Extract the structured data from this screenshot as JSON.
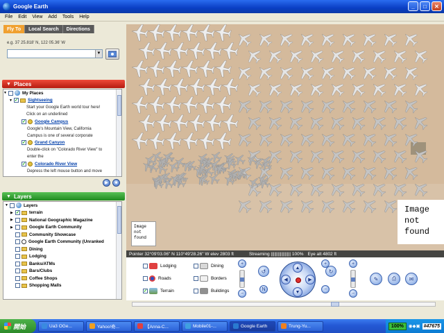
{
  "window": {
    "title": "Google Earth"
  },
  "menu": [
    "File",
    "Edit",
    "View",
    "Add",
    "Tools",
    "Help"
  ],
  "tabs": [
    {
      "label": "Fly To",
      "active": true
    },
    {
      "label": "Local Search",
      "active": false
    },
    {
      "label": "Directions",
      "active": false
    }
  ],
  "flyto": {
    "example": "e.g. 37 25.818' N, 122 05.36' W",
    "value": ""
  },
  "places": {
    "header": "Places",
    "root": "My Places",
    "sightseeing": "Sightseeing",
    "intro1": "Start your Google Earth world tour here!",
    "intro2": "Click on an underlined",
    "items": [
      {
        "label": "Google Campus",
        "desc1": "Google's Mountain View, California",
        "desc2": "Campus is one of several corporate"
      },
      {
        "label": "Grand Canyon",
        "desc1": "Double-click on \"Colorado River View\" to",
        "desc2": "enter the"
      },
      {
        "label": "Colorado River View",
        "desc1": "Depress the left mouse button and move"
      }
    ]
  },
  "layers": {
    "header": "Layers",
    "items": [
      {
        "label": "Layers",
        "checked": false,
        "bold": true,
        "kind": "globe"
      },
      {
        "label": "terrain",
        "checked": true,
        "bold": true,
        "kind": "folder"
      },
      {
        "label": "National Geographic Magazine",
        "checked": false,
        "bold": true,
        "kind": "folder"
      },
      {
        "label": "Google Earth Community",
        "checked": false,
        "bold": true,
        "kind": "folder"
      },
      {
        "label": "Community Showcase",
        "checked": false,
        "bold": true,
        "kind": "folder"
      },
      {
        "label": "Google Earth Community (Unranked",
        "checked": false,
        "bold": true,
        "kind": "info"
      },
      {
        "label": "Dining",
        "checked": false,
        "bold": true,
        "kind": "folder"
      },
      {
        "label": "Lodging",
        "checked": false,
        "bold": true,
        "kind": "folder"
      },
      {
        "label": "Banks/ATMs",
        "checked": false,
        "bold": true,
        "kind": "folder"
      },
      {
        "label": "Bars/Clubs",
        "checked": false,
        "bold": true,
        "kind": "folder"
      },
      {
        "label": "Coffee Shops",
        "checked": false,
        "bold": true,
        "kind": "folder"
      },
      {
        "label": "Shopping Malls",
        "checked": false,
        "bold": true,
        "kind": "folder"
      }
    ]
  },
  "map": {
    "image_not_found_small": "Image\nnot\nfound",
    "image_not_found_large": "Image\nnot\nfound",
    "pointer": "Pointer 32°09'03.06\" N   110°49'28.26\" W   elev 2803 ft",
    "streaming": "Streaming ||||||||||||||||| 100%",
    "eye_alt": "Eye alt    4802 ft"
  },
  "controls": {
    "lodging": "Lodging",
    "dining": "Dining",
    "roads": "Roads",
    "borders": "Borders",
    "terrain": "Terrain",
    "buildings": "Buildings",
    "terrain_checked": true
  },
  "taskbar": {
    "start": "開始",
    "items": [
      "Ua3 OGe...",
      "Yahoo!奇...",
      "【Anna-C...",
      "Mobile01-...",
      "Google Earth",
      "Trung-Yu..."
    ],
    "active_index": 4,
    "battery": "100%",
    "clock": "#47675"
  }
}
